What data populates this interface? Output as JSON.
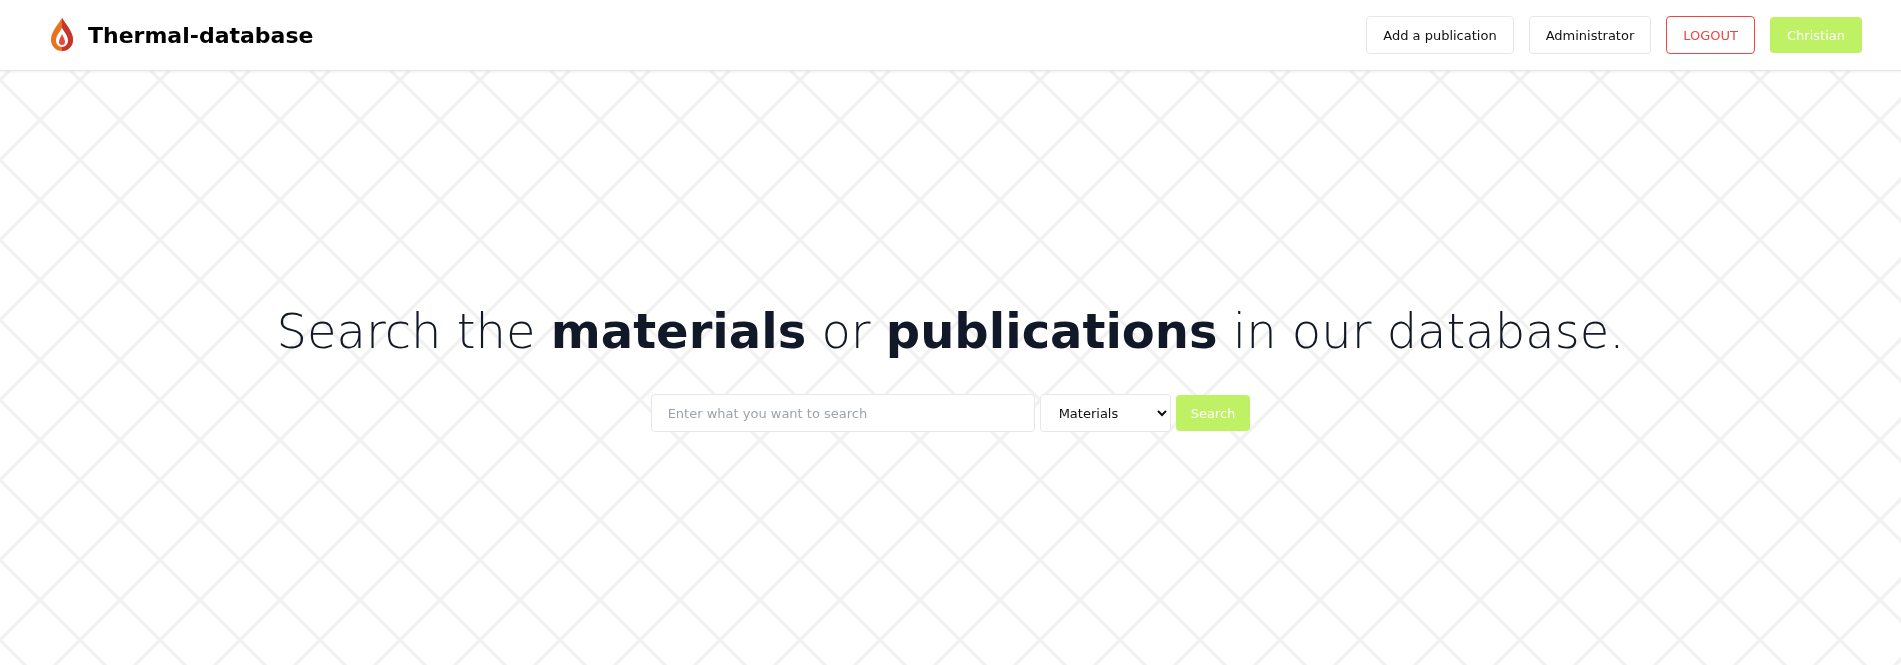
{
  "brand": {
    "name": "Thermal-database"
  },
  "nav": [
    {
      "label": "Add a publication",
      "kind": "outline"
    },
    {
      "label": "Administrator",
      "kind": "outline"
    },
    {
      "label": "LOGOUT",
      "kind": "danger"
    },
    {
      "label": "Christian",
      "kind": "primary"
    }
  ],
  "hero": {
    "heading": "Search the **materials** or **publications** in our database."
  },
  "search": {
    "placeholder": "Enter what you want to search",
    "category": "Materials",
    "button": "Search"
  }
}
